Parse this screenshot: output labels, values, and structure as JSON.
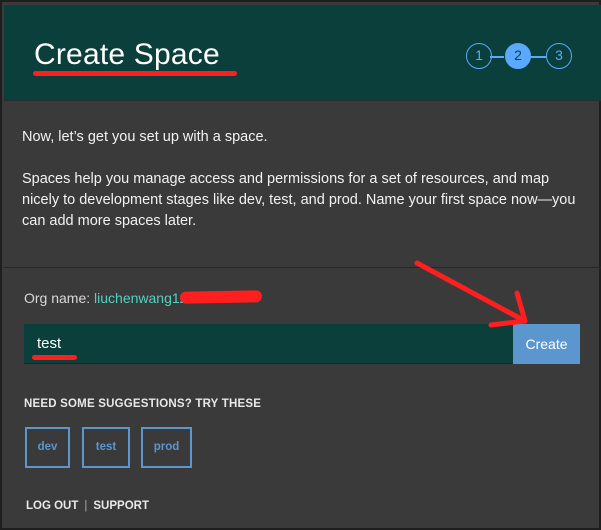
{
  "header": {
    "title": "Create Space",
    "steps": [
      "1",
      "2",
      "3"
    ],
    "active_step": 2
  },
  "intro": {
    "line1": "Now, let’s get you set up with a space.",
    "line2": "Spaces help you manage access and permissions for a set of resources, and map nicely to development stages like dev, test, and prod. Name your first space now—you can add more spaces later."
  },
  "org": {
    "label": "Org name:",
    "value": "liuchenwang12"
  },
  "space_form": {
    "input_value": "test",
    "create_label": "Create"
  },
  "suggestions": {
    "label": "NEED SOME SUGGESTIONS? TRY THESE",
    "chips": [
      "dev",
      "test",
      "prod"
    ]
  },
  "footer": {
    "logout": "LOG OUT",
    "separator": "|",
    "support": "SUPPORT"
  },
  "colors": {
    "header_bg": "#0a3f3b",
    "page_bg": "#3a3a3a",
    "accent_blue": "#5b96cf",
    "step_blue": "#5aa9ff",
    "org_teal": "#50d2c2",
    "annotation_red": "#ff1f1f"
  }
}
